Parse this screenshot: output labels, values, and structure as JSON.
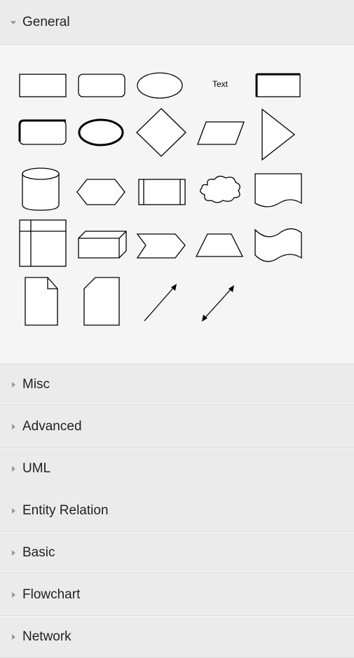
{
  "sections": [
    {
      "label": "General",
      "expanded": true
    },
    {
      "label": "Misc",
      "expanded": false
    },
    {
      "label": "Advanced",
      "expanded": false
    },
    {
      "label": "UML",
      "expanded": false
    },
    {
      "label": "Entity Relation",
      "expanded": false
    },
    {
      "label": "Basic",
      "expanded": false
    },
    {
      "label": "Flowchart",
      "expanded": false
    },
    {
      "label": "Network",
      "expanded": false
    }
  ],
  "general_shapes": {
    "text_shape_label": "Text",
    "items": [
      "rectangle-icon",
      "rounded-rectangle-icon",
      "ellipse-icon",
      "text-icon",
      "thick-rectangle-icon",
      "thick-rounded-rectangle-icon",
      "thick-ellipse-icon",
      "rhombus-icon",
      "parallelogram-icon",
      "triangle-icon",
      "cylinder-icon",
      "hexagon-icon",
      "process-icon",
      "cloud-icon",
      "document-icon",
      "internal-storage-icon",
      "cube-icon",
      "step-icon",
      "trapezoid-icon",
      "tape-icon",
      "note-icon",
      "card-icon",
      "connector-arrow-icon",
      "bidirectional-arrow-icon"
    ]
  },
  "colors": {
    "header_bg": "#ebebeb",
    "panel_bg": "#f5f5f5",
    "stroke": "#000000"
  }
}
